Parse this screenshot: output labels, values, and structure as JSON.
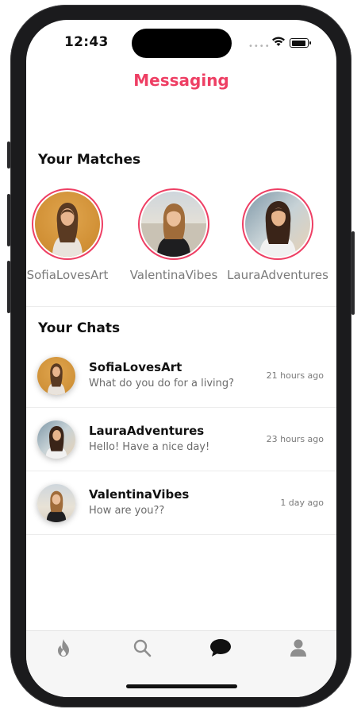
{
  "status": {
    "time": "12:43",
    "signal": "••••"
  },
  "header": {
    "title": "Messaging"
  },
  "matches": {
    "heading": "Your Matches",
    "items": [
      {
        "name": "SofiaLovesArt"
      },
      {
        "name": "ValentinaVibes"
      },
      {
        "name": "LauraAdventures"
      }
    ]
  },
  "chats": {
    "heading": "Your Chats",
    "items": [
      {
        "name": "SofiaLovesArt",
        "preview": "What do you do for a living?",
        "time": "21 hours ago"
      },
      {
        "name": "LauraAdventures",
        "preview": "Hello! Have a nice day!",
        "time": "23 hours ago"
      },
      {
        "name": "ValentinaVibes",
        "preview": "How are you??",
        "time": "1 day ago"
      }
    ]
  },
  "tabbar": {
    "tabs": [
      {
        "icon": "flame-icon"
      },
      {
        "icon": "search-icon"
      },
      {
        "icon": "chat-bubble-icon",
        "active": true
      },
      {
        "icon": "profile-icon"
      }
    ]
  },
  "colors": {
    "accent": "#ee3f64",
    "active_tab": "#111111",
    "inactive_tab": "#8e8e8e"
  }
}
